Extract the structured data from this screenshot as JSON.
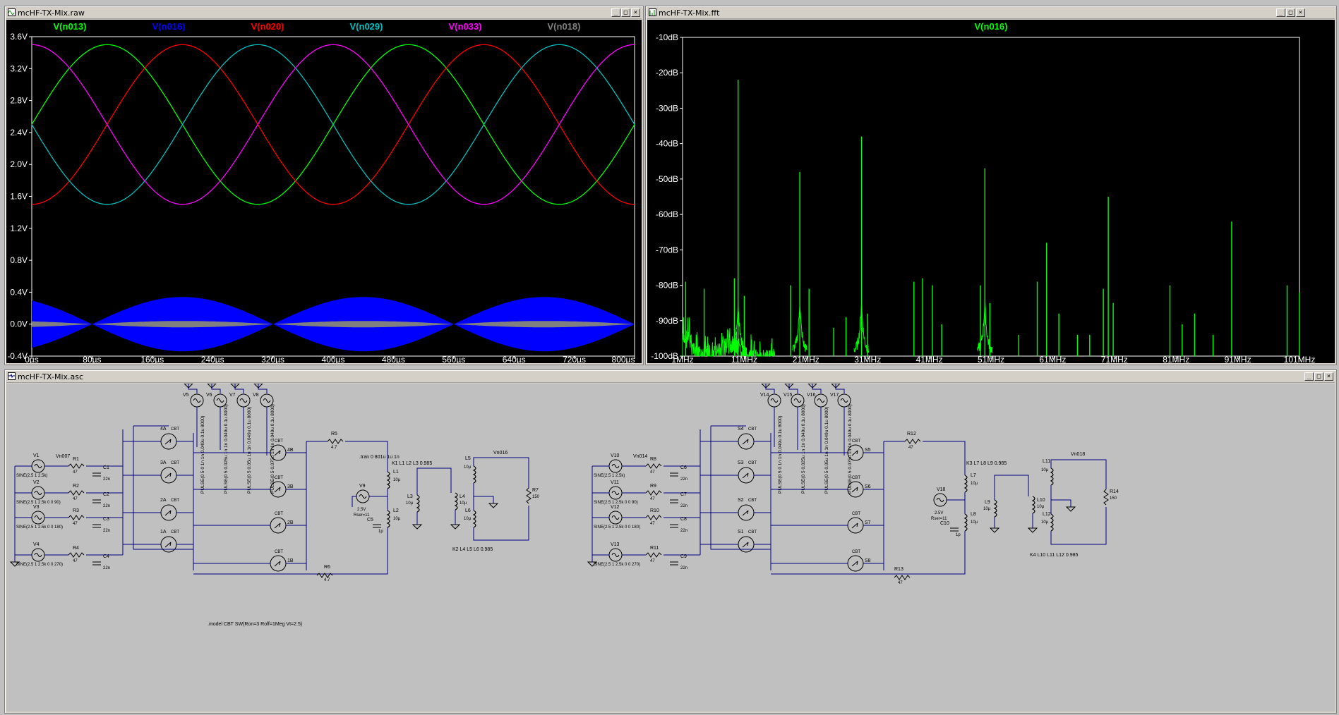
{
  "windows": {
    "raw": {
      "title": "mcHF-TX-Mix.raw"
    },
    "fft": {
      "title": "mcHF-TX-Mix.fft"
    },
    "asc": {
      "title": "mcHF-TX-Mix.asc"
    }
  },
  "window_buttons": {
    "minimize": "_",
    "restore": "□",
    "close": "×"
  },
  "colors": {
    "n013": "#00ff00",
    "n016": "#0000ff",
    "n020": "#ff0000",
    "n029": "#00c0c0",
    "n033": "#ff00ff",
    "n018": "#808080",
    "fft_trace": "#00ff00",
    "wire": "#000080"
  },
  "chart_data": [
    {
      "type": "line",
      "title": "",
      "series": [
        {
          "name": "V(n013)",
          "color": "#00ff00",
          "kind": "sine",
          "offset": 2.5,
          "amp": 1.0,
          "freq_khz": 2.5,
          "phase_deg": 0
        },
        {
          "name": "V(n016)",
          "color": "#0000ff",
          "kind": "envelope",
          "amp": 0.34
        },
        {
          "name": "V(n020)",
          "color": "#ff0000",
          "kind": "sine",
          "offset": 2.5,
          "amp": 1.0,
          "freq_khz": 2.5,
          "phase_deg": 90
        },
        {
          "name": "V(n029)",
          "color": "#00c0c0",
          "kind": "sine",
          "offset": 2.5,
          "amp": 1.0,
          "freq_khz": 2.5,
          "phase_deg": 180
        },
        {
          "name": "V(n033)",
          "color": "#ff00ff",
          "kind": "sine",
          "offset": 2.5,
          "amp": 1.0,
          "freq_khz": 2.5,
          "phase_deg": 270
        },
        {
          "name": "V(n018)",
          "color": "#808080",
          "kind": "envelope",
          "amp": 0.04
        }
      ],
      "x_ticks": [
        "0µs",
        "80µs",
        "160µs",
        "240µs",
        "320µs",
        "400µs",
        "480µs",
        "560µs",
        "640µs",
        "720µs",
        "800µs"
      ],
      "y_ticks": [
        "-0.4V",
        "0.0V",
        "0.4V",
        "0.8V",
        "1.2V",
        "1.6V",
        "2.0V",
        "2.4V",
        "2.8V",
        "3.2V",
        "3.6V"
      ],
      "xlim": [
        0,
        800
      ],
      "ylim": [
        -0.4,
        3.6
      ]
    },
    {
      "type": "line",
      "title": "V(n016)",
      "series": [
        {
          "name": "V(n016)",
          "color": "#00ff00"
        }
      ],
      "x_ticks": [
        "1MHz",
        "11MHz",
        "21MHz",
        "31MHz",
        "41MHz",
        "51MHz",
        "61MHz",
        "71MHz",
        "81MHz",
        "91MHz",
        "101MHz"
      ],
      "y_ticks": [
        "-100dB",
        "-90dB",
        "-80dB",
        "-70dB",
        "-60dB",
        "-50dB",
        "-40dB",
        "-30dB",
        "-20dB",
        "-10dB"
      ],
      "xlim": [
        1,
        101
      ],
      "ylim": [
        -100,
        -10
      ],
      "spurs": [
        {
          "f": 1.5,
          "db": -79
        },
        {
          "f": 4.5,
          "db": -81
        },
        {
          "f": 10.0,
          "db": -22
        },
        {
          "f": 9.4,
          "db": -78
        },
        {
          "f": 11.0,
          "db": -83
        },
        {
          "f": 15.5,
          "db": -95
        },
        {
          "f": 18.5,
          "db": -80
        },
        {
          "f": 20.0,
          "db": -48
        },
        {
          "f": 21.5,
          "db": -81
        },
        {
          "f": 25.5,
          "db": -92
        },
        {
          "f": 27.5,
          "db": -89
        },
        {
          "f": 30.0,
          "db": -38
        },
        {
          "f": 31.0,
          "db": -88
        },
        {
          "f": 38.5,
          "db": -79
        },
        {
          "f": 39.9,
          "db": -78
        },
        {
          "f": 41.5,
          "db": -80
        },
        {
          "f": 43.0,
          "db": -91
        },
        {
          "f": 50.0,
          "db": -47
        },
        {
          "f": 49.3,
          "db": -80
        },
        {
          "f": 50.8,
          "db": -85
        },
        {
          "f": 55.5,
          "db": -94
        },
        {
          "f": 58.5,
          "db": -79
        },
        {
          "f": 60.0,
          "db": -68
        },
        {
          "f": 62.0,
          "db": -88
        },
        {
          "f": 65.0,
          "db": -94
        },
        {
          "f": 67.0,
          "db": -94
        },
        {
          "f": 70.0,
          "db": -55
        },
        {
          "f": 69.2,
          "db": -81
        },
        {
          "f": 70.8,
          "db": -85
        },
        {
          "f": 80.0,
          "db": -80
        },
        {
          "f": 82.0,
          "db": -91
        },
        {
          "f": 84.0,
          "db": -88
        },
        {
          "f": 87.0,
          "db": -94
        },
        {
          "f": 90.0,
          "db": -62
        },
        {
          "f": 99.0,
          "db": -80
        },
        {
          "f": 101.0,
          "db": -82
        }
      ]
    }
  ],
  "schematic": {
    "left": {
      "sources": [
        {
          "name": "V1",
          "value": "SINE(2.5 1 2.5k)"
        },
        {
          "name": "V2",
          "value": "SINE(2.5 1 2.5k 0 0 90)"
        },
        {
          "name": "V3",
          "value": "SINE(2.5 1 2.5k 0 0 180)"
        },
        {
          "name": "V4",
          "value": "SINE(2.5 1 2.5k 0 0 270)"
        }
      ],
      "res": [
        {
          "name": "R1",
          "value": "47"
        },
        {
          "name": "R2",
          "value": "47"
        },
        {
          "name": "R3",
          "value": "47"
        },
        {
          "name": "R4",
          "value": "47"
        }
      ],
      "caps": [
        {
          "name": "C1",
          "value": "22n"
        },
        {
          "name": "C2",
          "value": "22n"
        },
        {
          "name": "C3",
          "value": "22n"
        },
        {
          "name": "C4",
          "value": "22n"
        }
      ],
      "node_in": "Vn007",
      "pulse": [
        {
          "name": "V5",
          "value": "PULSE(0 5 0 1n 1n 0.049u 0.1u 8000)"
        },
        {
          "name": "V6",
          "value": "PULSE(0 5 0.025u 1n 1n 0.049u 0.1u 8000)"
        },
        {
          "name": "V7",
          "value": "PULSE(0 5 0.05u 1n 1n 0.049u 0.1u 8000)"
        },
        {
          "name": "V8",
          "value": "PULSE(0 5 0.075u 1n 1n 0.049u 0.1u 8000)"
        }
      ],
      "switches": [
        {
          "name": "4A",
          "model": "CBT"
        },
        {
          "name": "3A",
          "model": "CBT"
        },
        {
          "name": "2A",
          "model": "CBT"
        },
        {
          "name": "1A",
          "model": "CBT"
        },
        {
          "name": "4B",
          "model": "CBT"
        },
        {
          "name": "3B",
          "model": "CBT"
        },
        {
          "name": "2B",
          "model": "CBT"
        },
        {
          "name": "1B",
          "model": "CBT"
        }
      ],
      "tran": ".tran 0 801u 1u 1n",
      "r5": {
        "name": "R5",
        "value": "4.7"
      },
      "r6": {
        "name": "R6",
        "value": "4.7"
      },
      "k1": "K1 L1 L2 L3 0.985",
      "k2": "K2 L4 L5 L6 0.985",
      "v9": {
        "name": "V9",
        "value": "2.5V",
        "rser": "Rser=11"
      },
      "c5": {
        "name": "C5",
        "value": "1p"
      },
      "inductors": [
        {
          "name": "L1",
          "value": "10µ"
        },
        {
          "name": "L2",
          "value": "10µ"
        },
        {
          "name": "L3",
          "value": "10µ"
        },
        {
          "name": "L4",
          "value": "10µ"
        },
        {
          "name": "L5",
          "value": "10µ"
        },
        {
          "name": "L6",
          "value": "10µ"
        }
      ],
      "r7": {
        "name": "R7",
        "value": "150"
      },
      "node_out": "Vn016",
      "model": ".model CBT SW(Ron=3 Roff=1Meg Vt=2.5)"
    },
    "right": {
      "sources": [
        {
          "name": "V10",
          "value": "SINE(2.5 1 2.5k)"
        },
        {
          "name": "V11",
          "value": "SINE(2.5 1 2.5k 0 0 90)"
        },
        {
          "name": "V12",
          "value": "SINE(2.5 1 2.5k 0 0 180)"
        },
        {
          "name": "V13",
          "value": "SINE(2.5 1 2.5k 0 0 270)"
        }
      ],
      "res": [
        {
          "name": "R8",
          "value": "47"
        },
        {
          "name": "R9",
          "value": "47"
        },
        {
          "name": "R10",
          "value": "47"
        },
        {
          "name": "R11",
          "value": "47"
        }
      ],
      "caps": [
        {
          "name": "C6",
          "value": "22n"
        },
        {
          "name": "C7",
          "value": "22n"
        },
        {
          "name": "C8",
          "value": "22n"
        },
        {
          "name": "C9",
          "value": "22n"
        }
      ],
      "node_in": "Vn014",
      "pulse": [
        {
          "name": "V14",
          "value": "PULSE(0 5 0 1n 1n 0.049u 0.1u 8000)"
        },
        {
          "name": "V15",
          "value": "PULSE(0 5 0.025u 1n 1n 0.049u 0.1u 8000)"
        },
        {
          "name": "V16",
          "value": "PULSE(0 5 0.05u 1n 1n 0.049u 0.1u 8000)"
        },
        {
          "name": "V17",
          "value": "PULSE(0 5 0.075u 1n 1n 0.049u 0.1u 8000)"
        }
      ],
      "switches": [
        {
          "name": "S4",
          "model": "CBT"
        },
        {
          "name": "S3",
          "model": "CBT"
        },
        {
          "name": "S2",
          "model": "CBT"
        },
        {
          "name": "S1",
          "model": "CBT"
        },
        {
          "name": "S5",
          "model": "CBT"
        },
        {
          "name": "S6",
          "model": "CBT"
        },
        {
          "name": "S7",
          "model": "CBT"
        },
        {
          "name": "S8",
          "model": "CBT"
        }
      ],
      "r12": {
        "name": "R12",
        "value": "47"
      },
      "r13": {
        "name": "R13",
        "value": "47"
      },
      "k3": "K3 L7 L8 L9 0.985",
      "k4": "K4 L10 L11 L12 0.985",
      "v18": {
        "name": "V18",
        "value": "2.5V",
        "rser": "Rser=11"
      },
      "c10": {
        "name": "C10",
        "value": "1p"
      },
      "inductors": [
        {
          "name": "L7",
          "value": "10µ"
        },
        {
          "name": "L8",
          "value": "10µ"
        },
        {
          "name": "L9",
          "value": "10µ"
        },
        {
          "name": "L10",
          "value": "10µ"
        },
        {
          "name": "L11",
          "value": "10µ"
        },
        {
          "name": "L12",
          "value": "10µ"
        }
      ],
      "r14": {
        "name": "R14",
        "value": "150"
      },
      "node_out": "Vn018"
    }
  }
}
